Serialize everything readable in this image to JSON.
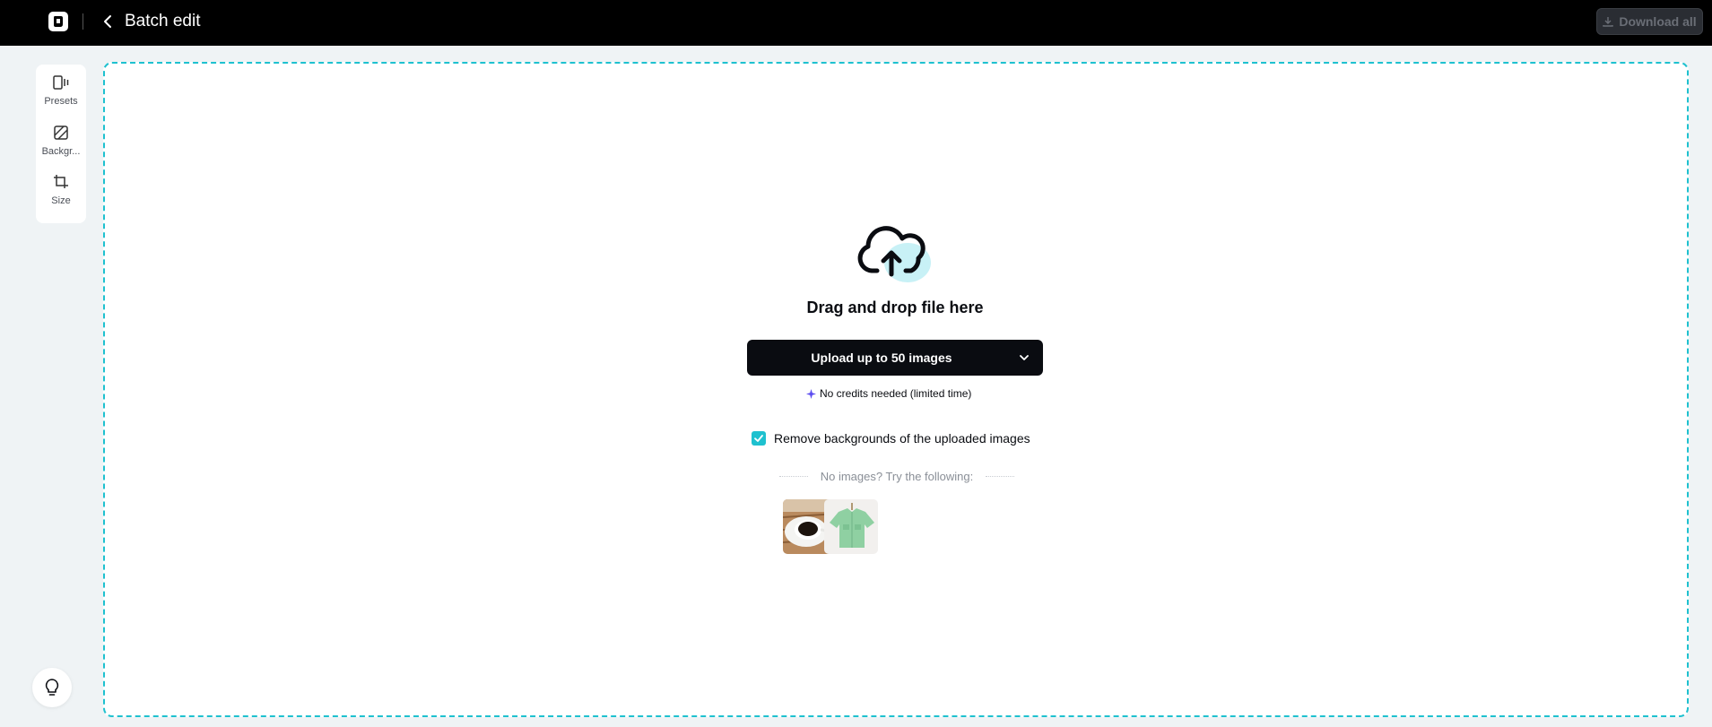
{
  "header": {
    "title": "Batch edit",
    "download_label": "Download all"
  },
  "sidebar": {
    "items": [
      {
        "label": "Presets",
        "icon": "presets-icon"
      },
      {
        "label": "Backgr...",
        "icon": "background-icon"
      },
      {
        "label": "Size",
        "icon": "crop-icon"
      }
    ]
  },
  "dropzone": {
    "drag_text": "Drag and drop file here",
    "upload_label": "Upload up to 50 images",
    "credits_text": "No credits needed (limited time)",
    "checkbox_label": "Remove backgrounds of the uploaded images",
    "checkbox_checked": true,
    "try_text": "No images? Try the following:",
    "samples": [
      "coffee-cup-sample",
      "green-shirt-sample"
    ]
  },
  "colors": {
    "accent": "#1ec1cf",
    "topbar": "#000000",
    "button": "#0a0c11",
    "sparkle": "#5b4cf0"
  }
}
